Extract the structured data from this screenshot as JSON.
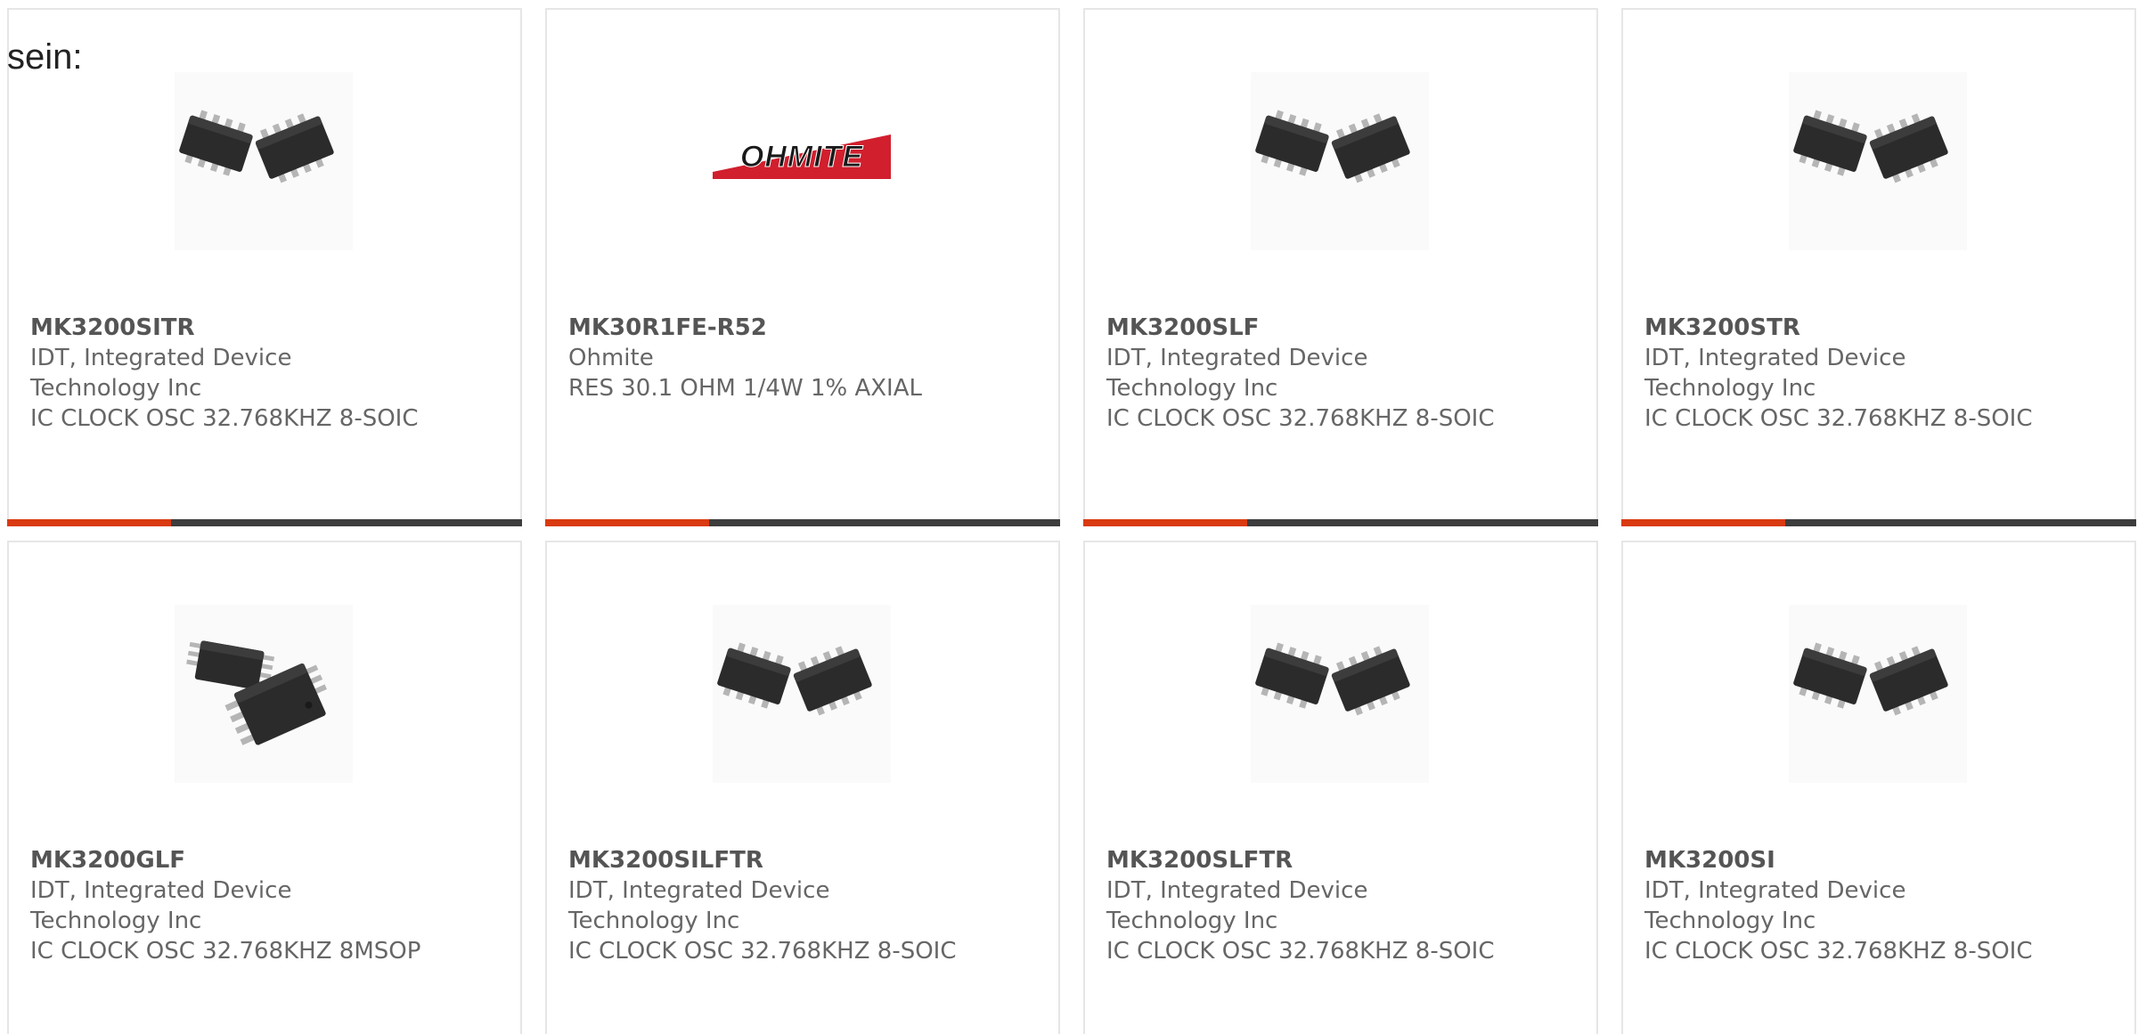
{
  "intro": {
    "text": "sein:"
  },
  "products": [
    {
      "part_number": "MK3200SITR",
      "manufacturer": "IDT, Integrated Device\nTechnology Inc",
      "description": "IC CLOCK OSC 32.768KHZ 8-SOIC",
      "image": "soic-8-chip-pair-icon"
    },
    {
      "part_number": "MK30R1FE-R52",
      "manufacturer": "Ohmite",
      "description": "RES 30.1 OHM 1/4W 1% AXIAL",
      "image": "ohmite-logo",
      "logo_text": "OHMITE"
    },
    {
      "part_number": "MK3200SLF",
      "manufacturer": "IDT, Integrated Device\nTechnology Inc",
      "description": "IC CLOCK OSC 32.768KHZ 8-SOIC",
      "image": "soic-8-chip-pair-icon"
    },
    {
      "part_number": "MK3200STR",
      "manufacturer": "IDT, Integrated Device\nTechnology Inc",
      "description": "IC CLOCK OSC 32.768KHZ 8-SOIC",
      "image": "soic-8-chip-pair-icon"
    },
    {
      "part_number": "MK3200GLF",
      "manufacturer": "IDT, Integrated Device\nTechnology Inc",
      "description": "IC CLOCK OSC 32.768KHZ 8MSOP",
      "image": "msop-8-chip-pair-icon"
    },
    {
      "part_number": "MK3200SILFTR",
      "manufacturer": "IDT, Integrated Device\nTechnology Inc",
      "description": "IC CLOCK OSC 32.768KHZ 8-SOIC",
      "image": "soic-8-chip-pair-icon"
    },
    {
      "part_number": "MK3200SLFTR",
      "manufacturer": "IDT, Integrated Device\nTechnology Inc",
      "description": "IC CLOCK OSC 32.768KHZ 8-SOIC",
      "image": "soic-8-chip-pair-icon"
    },
    {
      "part_number": "MK3200SI",
      "manufacturer": "IDT, Integrated Device\nTechnology Inc",
      "description": "IC CLOCK OSC 32.768KHZ 8-SOIC",
      "image": "soic-8-chip-pair-icon"
    }
  ],
  "colors": {
    "accent": "#d93a10",
    "bar": "#3d3d3d",
    "border": "#e6e6e6",
    "text": "#666666"
  }
}
